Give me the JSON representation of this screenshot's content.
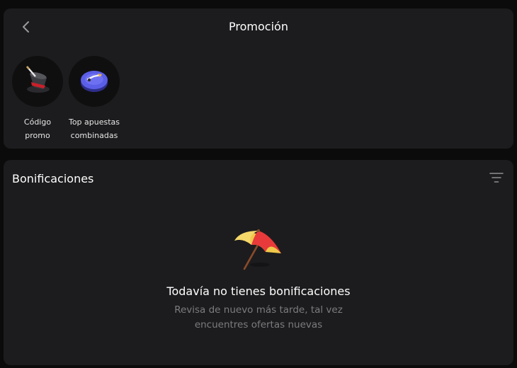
{
  "header": {
    "title": "Promoción",
    "back_icon": "chevron-left-icon"
  },
  "promotions": [
    {
      "label_line1": "Código",
      "label_line2": "promo",
      "icon": "magic-hat-icon"
    },
    {
      "label_line1": "Top apuestas",
      "label_line2": "combinadas",
      "icon": "trophy-disc-icon"
    }
  ],
  "bonuses": {
    "title": "Bonificaciones",
    "filter_icon": "filter-icon",
    "empty_icon": "beach-umbrella-icon",
    "empty_title": "Todavía no tienes bonificaciones",
    "empty_desc_line1": "Revisa de nuevo más tarde, tal vez",
    "empty_desc_line2": "encuentres ofertas nuevas"
  },
  "colors": {
    "background": "#0b0b0c",
    "card": "#1c1c1e",
    "text_primary": "#ffffff",
    "text_secondary": "#7c7c80"
  }
}
